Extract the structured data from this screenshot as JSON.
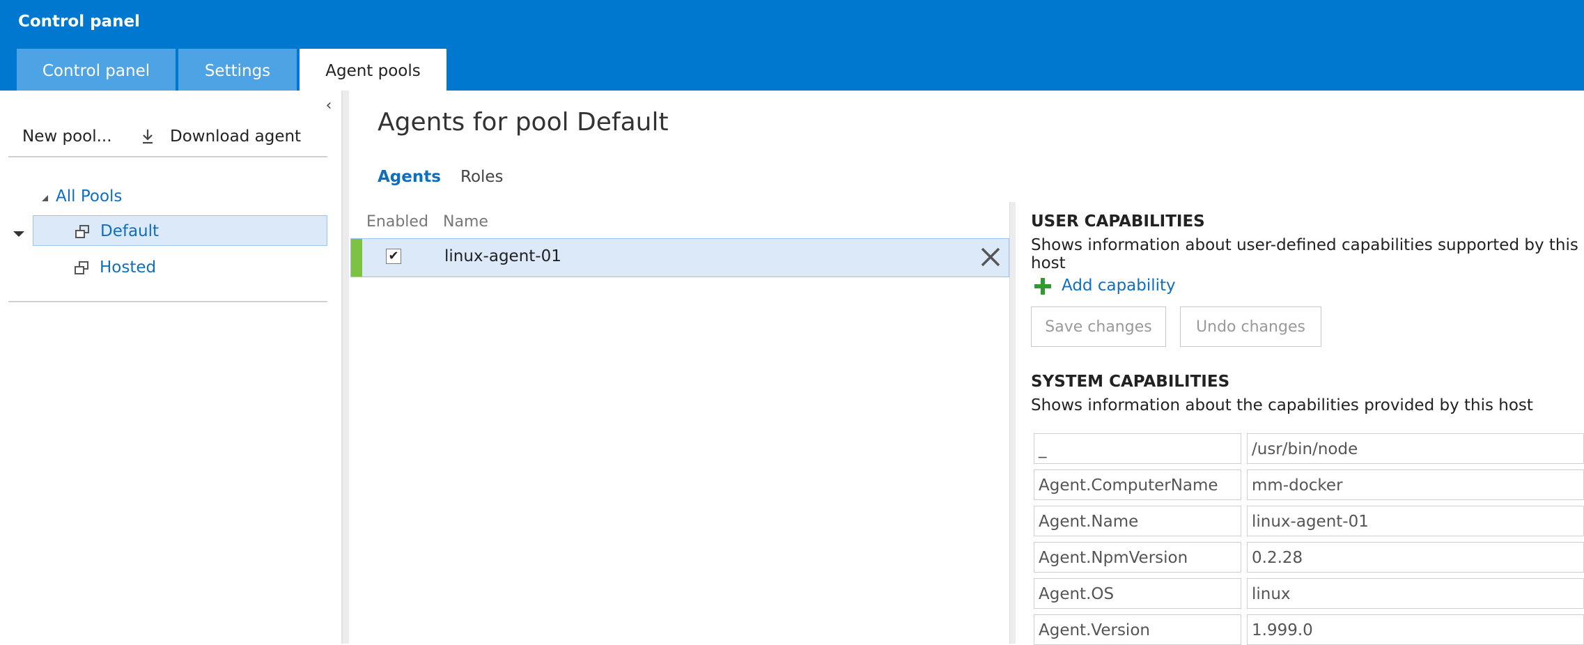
{
  "app": {
    "title": "Control panel"
  },
  "tabs": [
    {
      "label": "Control panel"
    },
    {
      "label": "Settings"
    },
    {
      "label": "Agent pools"
    }
  ],
  "left_panel": {
    "collapse_glyph": "‹",
    "toolbar": {
      "new_pool": "New pool...",
      "download_agent": "Download agent"
    },
    "tree": {
      "root": "All Pools",
      "items": [
        {
          "label": "Default"
        },
        {
          "label": "Hosted"
        }
      ]
    }
  },
  "main": {
    "title": "Agents for pool Default",
    "subtabs": [
      {
        "label": "Agents"
      },
      {
        "label": "Roles"
      }
    ],
    "columns": {
      "enabled": "Enabled",
      "name": "Name"
    },
    "agents": [
      {
        "name": "linux-agent-01",
        "enabled": true
      }
    ]
  },
  "user_capabilities": {
    "title": "USER CAPABILITIES",
    "description": "Shows information about user-defined capabilities supported by this host",
    "add_label": "Add capability",
    "save_label": "Save changes",
    "undo_label": "Undo changes"
  },
  "system_capabilities": {
    "title": "SYSTEM CAPABILITIES",
    "description": "Shows information about the capabilities provided by this host",
    "rows": [
      {
        "key": "_",
        "value": "/usr/bin/node"
      },
      {
        "key": "Agent.ComputerName",
        "value": "mm-docker"
      },
      {
        "key": "Agent.Name",
        "value": "linux-agent-01"
      },
      {
        "key": "Agent.NpmVersion",
        "value": "0.2.28"
      },
      {
        "key": "Agent.OS",
        "value": "linux"
      },
      {
        "key": "Agent.Version",
        "value": "1.999.0"
      }
    ]
  },
  "colors": {
    "header": "#0078d0",
    "inactive_tab": "#4da3e3",
    "link": "#106ebe",
    "selected_bg": "#dbe9f8",
    "status_green": "#7dc242",
    "plus_green": "#339933"
  }
}
